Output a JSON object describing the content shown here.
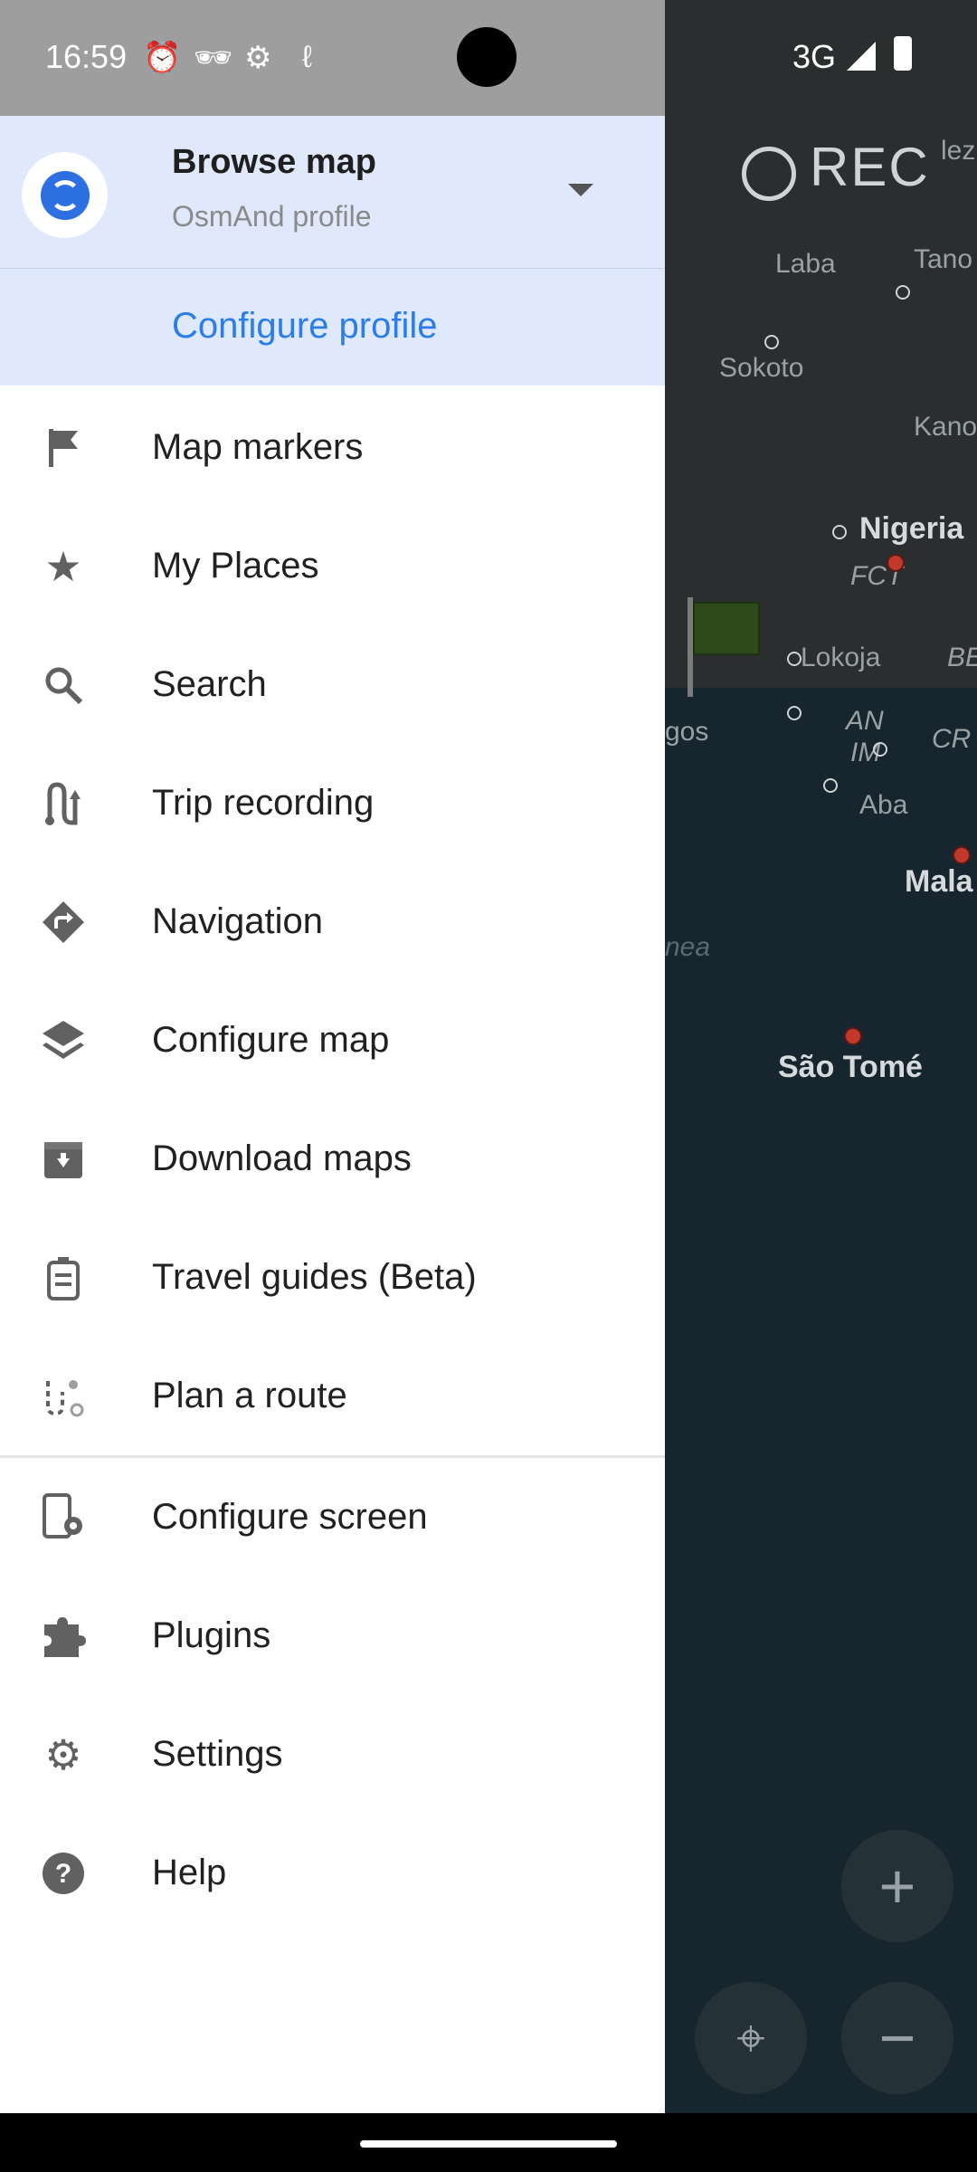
{
  "status_bar": {
    "time": "16:59",
    "network": "3G",
    "icons": [
      "alarm-icon",
      "incognito-icon",
      "settings-icon",
      "trip-icon",
      "signal-icon",
      "battery-icon"
    ]
  },
  "map": {
    "labels": [
      "Laba",
      "Sokoto",
      "Tano",
      "Kano",
      "Nigeria",
      "FCT",
      "Lokoja",
      "Aba",
      "Mala",
      "São Tomé",
      "gos",
      "BE",
      "CR",
      "AN",
      "IM",
      "nea",
      "lez"
    ],
    "rec_label": "REC"
  },
  "drawer": {
    "header": {
      "title": "Browse map",
      "subtitle": "OsmAnd profile",
      "configure_profile": "Configure profile"
    },
    "menu": [
      {
        "label": "Map markers",
        "icon": "flag-icon"
      },
      {
        "label": "My Places",
        "icon": "star-icon"
      },
      {
        "label": "Search",
        "icon": "search-icon"
      },
      {
        "label": "Trip recording",
        "icon": "trip-recording-icon"
      },
      {
        "label": "Navigation",
        "icon": "navigation-icon"
      },
      {
        "label": "Configure map",
        "icon": "layers-icon"
      },
      {
        "label": "Download maps",
        "icon": "download-icon"
      },
      {
        "label": "Travel guides (Beta)",
        "icon": "travel-guide-icon"
      },
      {
        "label": "Plan a route",
        "icon": "plan-route-icon"
      },
      {
        "label": "Configure screen",
        "icon": "configure-screen-icon"
      },
      {
        "label": "Plugins",
        "icon": "puzzle-icon"
      },
      {
        "label": "Settings",
        "icon": "gear-icon"
      },
      {
        "label": "Help",
        "icon": "help-icon"
      }
    ]
  },
  "colors": {
    "header_bg": "#dfe9fb",
    "accent": "#2b7de9",
    "icon": "#616161"
  }
}
